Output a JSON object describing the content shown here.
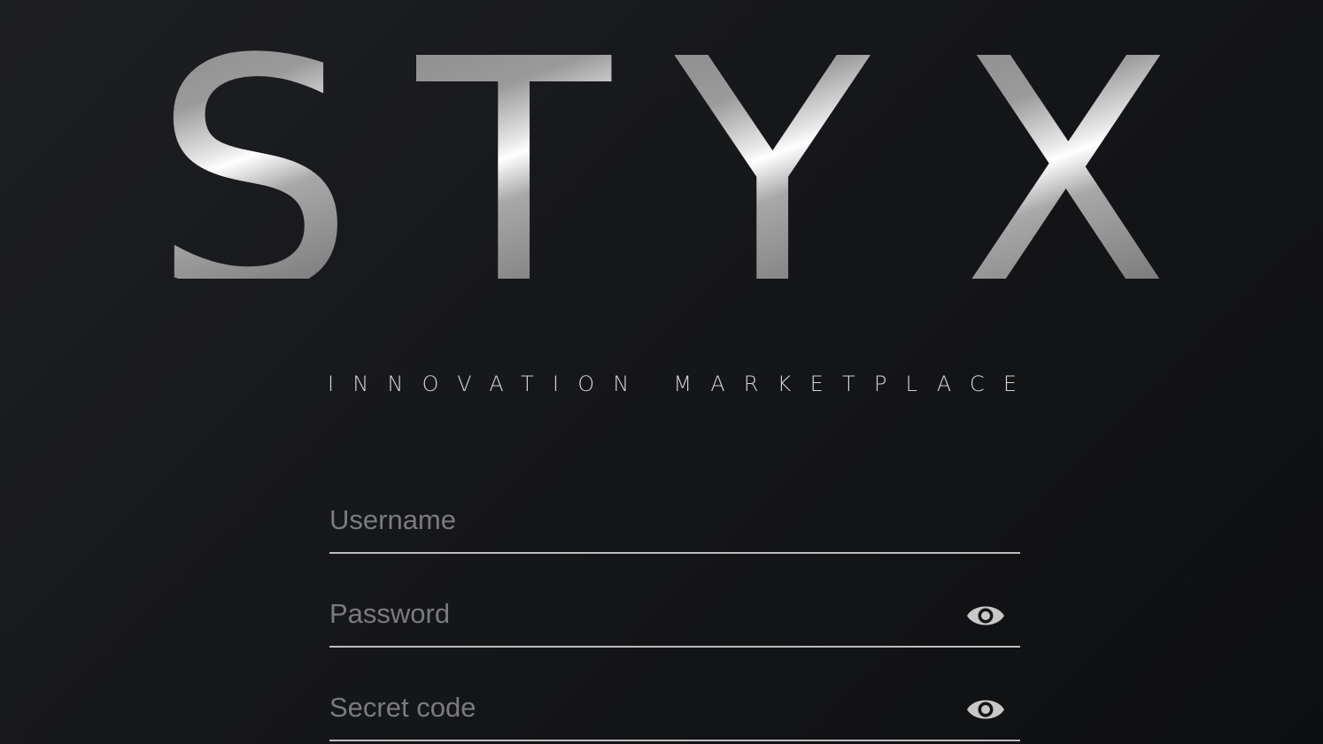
{
  "logo": {
    "letters": [
      "S",
      "T",
      "Y",
      "X"
    ]
  },
  "tagline": "INNOVATION MARKETPLACE",
  "form": {
    "username": {
      "placeholder": "Username",
      "value": ""
    },
    "password": {
      "placeholder": "Password",
      "value": "",
      "toggle_icon": "eye-icon"
    },
    "secret_code": {
      "placeholder": "Secret code",
      "value": "",
      "toggle_icon": "eye-icon"
    }
  },
  "colors": {
    "background": "#16171a",
    "underline": "#bdbdbd",
    "placeholder": "#7a7b7e",
    "icon": "#c8c8c8"
  }
}
